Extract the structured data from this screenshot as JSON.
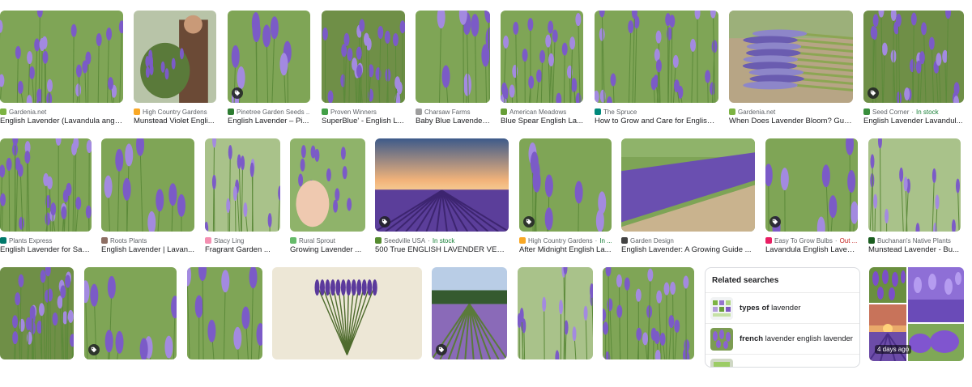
{
  "results": [
    {
      "source": "Gardenia.net",
      "title": "English Lavender (Lavandula angu...",
      "fav": "#7cb342",
      "scene": "field",
      "badge": false
    },
    {
      "source": "High Country Gardens",
      "title": "Munstead Violet Engli...",
      "fav": "#f9a825",
      "scene": "person",
      "badge": false
    },
    {
      "source": "Pinetree Garden Seeds ...",
      "title": "English Lavender – Pi...",
      "fav": "#2e7d32",
      "scene": "closeup",
      "badge": true
    },
    {
      "source": "Proven Winners",
      "title": "SuperBlue' - English L...",
      "fav": "#43a047",
      "scene": "bush",
      "badge": false
    },
    {
      "source": "Charsaw Farms",
      "title": "Baby Blue Lavender...",
      "fav": "#9e9e9e",
      "scene": "closeup",
      "badge": false
    },
    {
      "source": "American Meadows",
      "title": "Blue Spear English La...",
      "fav": "#689f38",
      "scene": "field",
      "badge": false
    },
    {
      "source": "The Spruce",
      "title": "How to Grow and Care for English ...",
      "fav": "#00897b",
      "scene": "field",
      "badge": false
    },
    {
      "source": "Gardenia.net",
      "title": "When Does Lavender Bloom? Guid...",
      "fav": "#7cb342",
      "scene": "bundle",
      "badge": false
    },
    {
      "source": "Seed Corner",
      "stock": "In stock",
      "title": "English Lavender Lavandul...",
      "fav": "#388e3c",
      "scene": "bush",
      "badge": true
    },
    {
      "source": "Plants Express",
      "title": "English Lavender for Sale...",
      "fav": "#00796b",
      "scene": "field",
      "badge": false
    },
    {
      "source": "Roots Plants",
      "title": "English Lavender | Lavan...",
      "fav": "#8d6e63",
      "scene": "closeup",
      "badge": false
    },
    {
      "source": "Stacy Ling",
      "title": "Fragrant Garden ...",
      "fav": "#f48fb1",
      "scene": "stems",
      "badge": false
    },
    {
      "source": "Rural Sprout",
      "title": "Growing Lavender ...",
      "fav": "#66bb6a",
      "scene": "hand",
      "badge": false
    },
    {
      "source": "Seedville USA",
      "stock": "In stock",
      "title": "500 True ENGLISH LAVENDER VERA ...",
      "fav": "#558b2f",
      "scene": "sunset",
      "badge": true
    },
    {
      "source": "High Country Gardens",
      "stock": "In ...",
      "title": "After Midnight English La...",
      "fav": "#f9a825",
      "scene": "closeup",
      "badge": true
    },
    {
      "source": "Garden Design",
      "title": "English Lavender: A Growing Guide ...",
      "fav": "#424242",
      "scene": "hedge",
      "badge": false
    },
    {
      "source": "Easy To Grow Bulbs",
      "stock": "Out ...",
      "title": "Lavandula English Laven...",
      "fav": "#e91e63",
      "scene": "closeup",
      "badge": true
    },
    {
      "source": "Buchanan's Native Plants",
      "title": "Munstead Lavender - Bu...",
      "fav": "#1b5e20",
      "scene": "stems",
      "badge": false
    },
    {
      "source": "",
      "title": "",
      "fav": "#888",
      "scene": "bush",
      "badge": false
    },
    {
      "source": "",
      "title": "",
      "fav": "#888",
      "scene": "closeup",
      "badge": true
    },
    {
      "source": "",
      "title": "",
      "fav": "#888",
      "scene": "closeup",
      "badge": false
    },
    {
      "source": "",
      "title": "",
      "fav": "#888",
      "scene": "illustration",
      "badge": false
    },
    {
      "source": "",
      "title": "",
      "fav": "#888",
      "scene": "rows",
      "badge": true
    },
    {
      "source": "",
      "title": "",
      "fav": "#888",
      "scene": "stems",
      "badge": false
    },
    {
      "source": "",
      "title": "",
      "fav": "#888",
      "scene": "field",
      "badge": false
    }
  ],
  "related": {
    "heading": "Related searches",
    "items": [
      {
        "bold": "types of",
        "rest": " lavender",
        "icon": "chart-thumb"
      },
      {
        "bold": "french",
        "rest": " lavender english lavender",
        "icon": "lavender-thumb"
      },
      {
        "bold": "",
        "rest": "",
        "icon": "partial-thumb"
      }
    ]
  },
  "collage": {
    "timestamp": "4 days ago"
  },
  "colors": {
    "lavender": "#7b5bc7",
    "lavender_light": "#a38ae0",
    "stem": "#5c8a3a",
    "green_bg": "#8fb36a",
    "in_stock": "#188038",
    "out_stock": "#c5221f"
  }
}
